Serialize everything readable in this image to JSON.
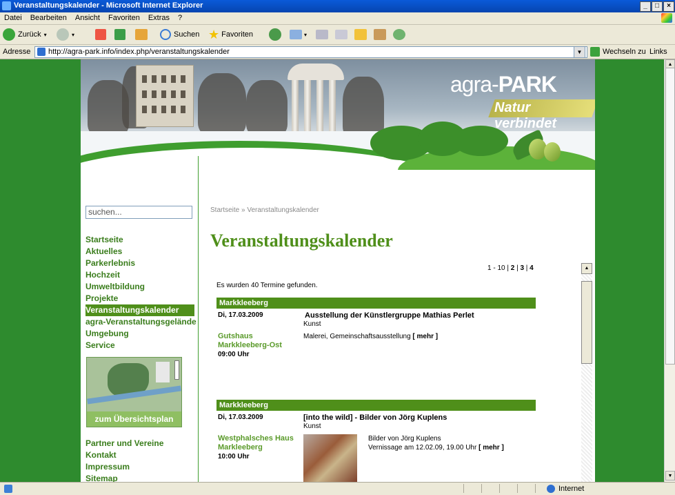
{
  "window": {
    "title": "Veranstaltungskalender - Microsoft Internet Explorer",
    "controls": [
      "_",
      "□",
      "×"
    ]
  },
  "menubar": [
    "Datei",
    "Bearbeiten",
    "Ansicht",
    "Favoriten",
    "Extras",
    "?"
  ],
  "toolbar": {
    "back_label": "Zurück",
    "search_label": "Suchen",
    "favorites_label": "Favoriten"
  },
  "addressbar": {
    "label": "Adresse",
    "url": "http://agra-park.info/index.php/veranstaltungskalender",
    "go_label": "Wechseln zu",
    "links_label": "Links"
  },
  "banner": {
    "logo_prefix": "agra-",
    "logo_strong": "PARK",
    "tagline": "Natur verbindet"
  },
  "sidebar": {
    "search_placeholder": "suchen...",
    "items": [
      {
        "label": "Startseite",
        "active": false
      },
      {
        "label": "Aktuelles",
        "active": false
      },
      {
        "label": "Parkerlebnis",
        "active": false
      },
      {
        "label": "Hochzeit",
        "active": false
      },
      {
        "label": "Umweltbildung",
        "active": false
      },
      {
        "label": "Projekte",
        "active": false
      },
      {
        "label": "Veranstaltungskalender",
        "active": true
      },
      {
        "label": "agra-Veranstaltungsgelände",
        "active": false
      },
      {
        "label": "Umgebung",
        "active": false
      },
      {
        "label": "Service",
        "active": false
      }
    ],
    "map_label": "zum Übersichtsplan",
    "items2": [
      {
        "label": "Partner und Vereine"
      },
      {
        "label": "Kontakt"
      },
      {
        "label": "Impressum"
      },
      {
        "label": "Sitemap"
      }
    ]
  },
  "main": {
    "breadcrumb": "Startseite » Veranstaltungskalender",
    "title": "Veranstaltungskalender",
    "pager": {
      "current": "1 - 10",
      "pages": [
        "2",
        "3",
        "4"
      ]
    },
    "count_text": "Es wurden 40 Termine gefunden.",
    "events": [
      {
        "place": "Markkleeberg",
        "date": "Di, 17.03.2009",
        "title": "Ausstellung der Künstlergruppe Mathias Perlet",
        "category": "Kunst",
        "location": "Gutshaus Markkleeberg-Ost",
        "time": "09:00 Uhr",
        "description": "Malerei, Gemeinschaftsausstellung",
        "more": "[ mehr ]"
      },
      {
        "place": "Markkleeberg",
        "date": "Di, 17.03.2009",
        "title": "[into the wild] - Bilder von Jörg Kuplens",
        "category": "Kunst",
        "location": "Westphalsches Haus Markleeberg",
        "time": "10:00 Uhr",
        "description": "Bilder von Jörg Kuplens",
        "description2": "Vernissage am 12.02.09, 19.00 Uhr",
        "more": "[ mehr ]"
      }
    ]
  },
  "statusbar": {
    "zone": "Internet"
  },
  "colors": {
    "brand_green": "#4f8f1a",
    "link_green": "#3a7d1c",
    "page_bg": "#2e8b2e"
  }
}
